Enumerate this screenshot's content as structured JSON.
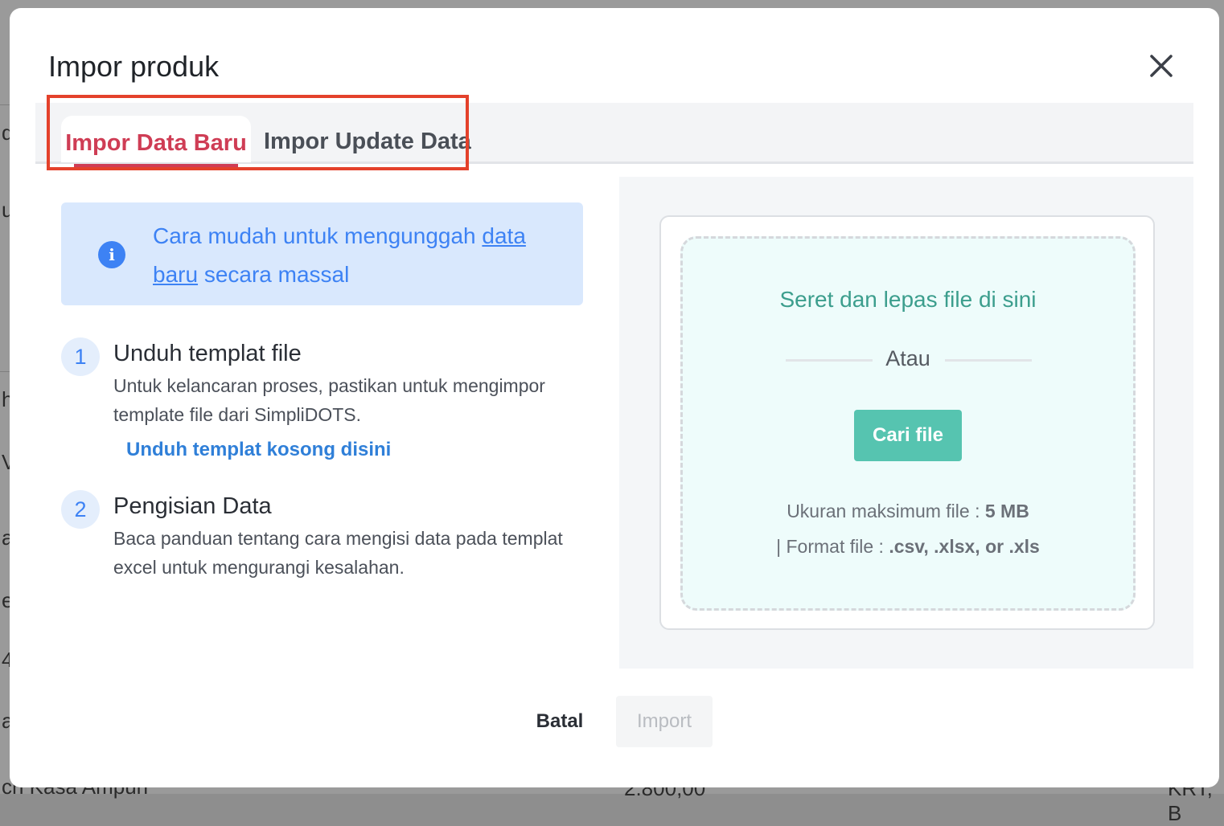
{
  "modal": {
    "title": "Impor produk"
  },
  "tabs": [
    {
      "label": "Impor Data Baru",
      "active": true
    },
    {
      "label": "Impor Update Data",
      "active": false
    }
  ],
  "info": {
    "prefix": "Cara mudah untuk mengunggah ",
    "link_part1": "data",
    "link_part2": "baru",
    "suffix": " secara massal"
  },
  "steps": [
    {
      "number": "1",
      "title": "Unduh templat file",
      "description": "Untuk kelancaran proses, pastikan untuk mengimpor template file dari SimpliDOTS.",
      "link": "Unduh templat kosong disini"
    },
    {
      "number": "2",
      "title": "Pengisian Data",
      "description": "Baca panduan tentang cara mengisi data pada templat excel untuk mengurangi kesalahan."
    }
  ],
  "upload": {
    "drop_text": "Seret dan lepas file di sini",
    "or_text": "Atau",
    "browse_label": "Cari file",
    "max_size_label": "Ukuran maksimum file : ",
    "max_size_value": "5 MB",
    "format_label": "| Format file : ",
    "format_value": ".csv, .xlsx, or .xls"
  },
  "footer": {
    "cancel_label": "Batal",
    "import_label": "Import"
  },
  "background_fragments": [
    "d",
    "u",
    "h",
    "V",
    "a",
    "e",
    "4",
    "a",
    "ch Kasa Ampuh",
    "2.800,00",
    "KRT, B"
  ],
  "colors": {
    "accent_tab": "#cf3d55",
    "info_blue": "#3d82f4",
    "browse_button": "#56c4b0",
    "highlight_box": "#e4412b"
  }
}
